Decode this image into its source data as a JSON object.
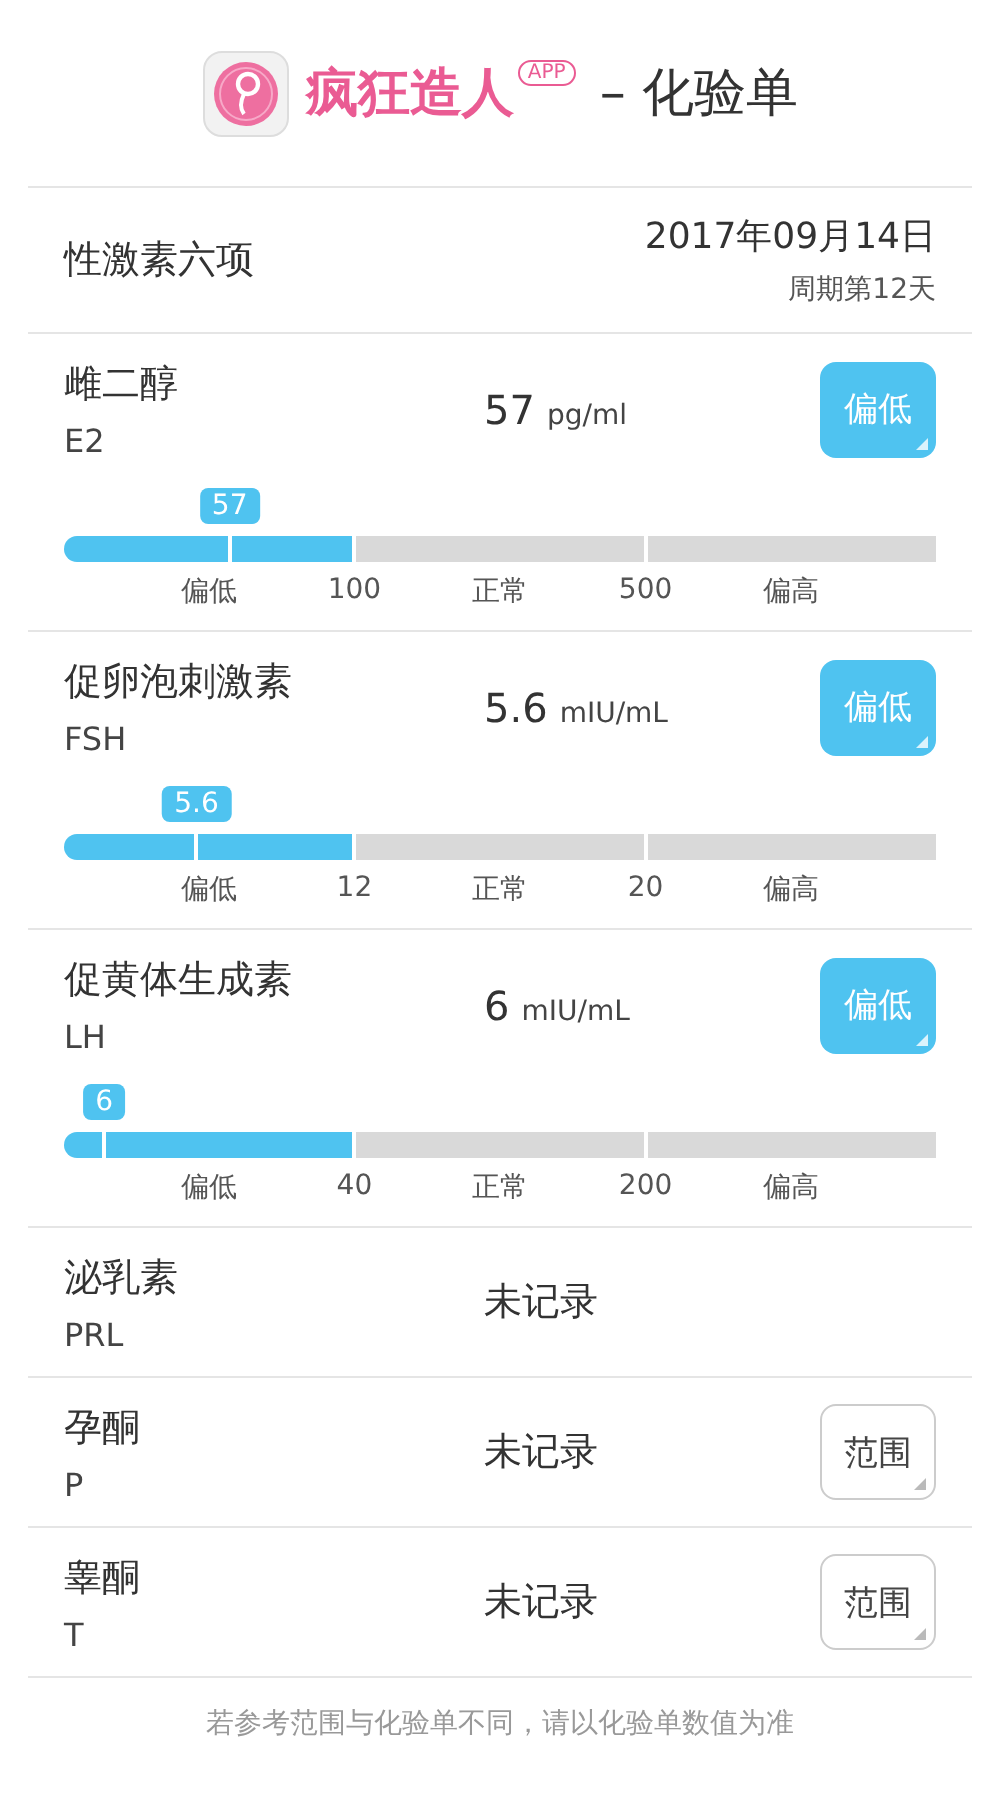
{
  "header": {
    "brand": "疯狂造人",
    "badge": "APP",
    "title": "– 化验单"
  },
  "panel": {
    "title": "性激素六项",
    "date": "2017年09月14日",
    "cycle": "周期第12天"
  },
  "tests": [
    {
      "kind": "slider",
      "name": "雌二醇",
      "code": "E2",
      "value": "57",
      "unit": "pg/ml",
      "button": {
        "label": "偏低",
        "kind": "filled"
      },
      "marker": "57",
      "level": 0.19,
      "segments": [
        {
          "highlighted": true
        },
        {
          "highlighted": false
        },
        {
          "highlighted": false
        }
      ],
      "scale": [
        "偏低",
        "100",
        "正常",
        "500",
        "偏高"
      ]
    },
    {
      "kind": "slider",
      "name": "促卵泡刺激素",
      "code": "FSH",
      "value": "5.6",
      "unit": "mIU/mL",
      "button": {
        "label": "偏低",
        "kind": "filled"
      },
      "marker": "5.6",
      "level": 0.152,
      "segments": [
        {
          "highlighted": true
        },
        {
          "highlighted": false
        },
        {
          "highlighted": false
        }
      ],
      "scale": [
        "偏低",
        "12",
        "正常",
        "20",
        "偏高"
      ]
    },
    {
      "kind": "slider",
      "name": "促黄体生成素",
      "code": "LH",
      "value": "6",
      "unit": "mIU/mL",
      "button": {
        "label": "偏低",
        "kind": "filled"
      },
      "marker": "6",
      "level": 0.046,
      "segments": [
        {
          "highlighted": true
        },
        {
          "highlighted": false
        },
        {
          "highlighted": false
        }
      ],
      "scale": [
        "偏低",
        "40",
        "正常",
        "200",
        "偏高"
      ]
    },
    {
      "kind": "plain",
      "name": "泌乳素",
      "code": "PRL",
      "value": "未记录"
    },
    {
      "kind": "plain",
      "name": "孕酮",
      "code": "P",
      "value": "未记录",
      "button": {
        "label": "范围",
        "kind": "outline"
      }
    },
    {
      "kind": "plain",
      "name": "睾酮",
      "code": "T",
      "value": "未记录",
      "button": {
        "label": "范围",
        "kind": "outline"
      }
    }
  ],
  "footer": "若参考范围与化验单不同，请以化验单数值为准"
}
